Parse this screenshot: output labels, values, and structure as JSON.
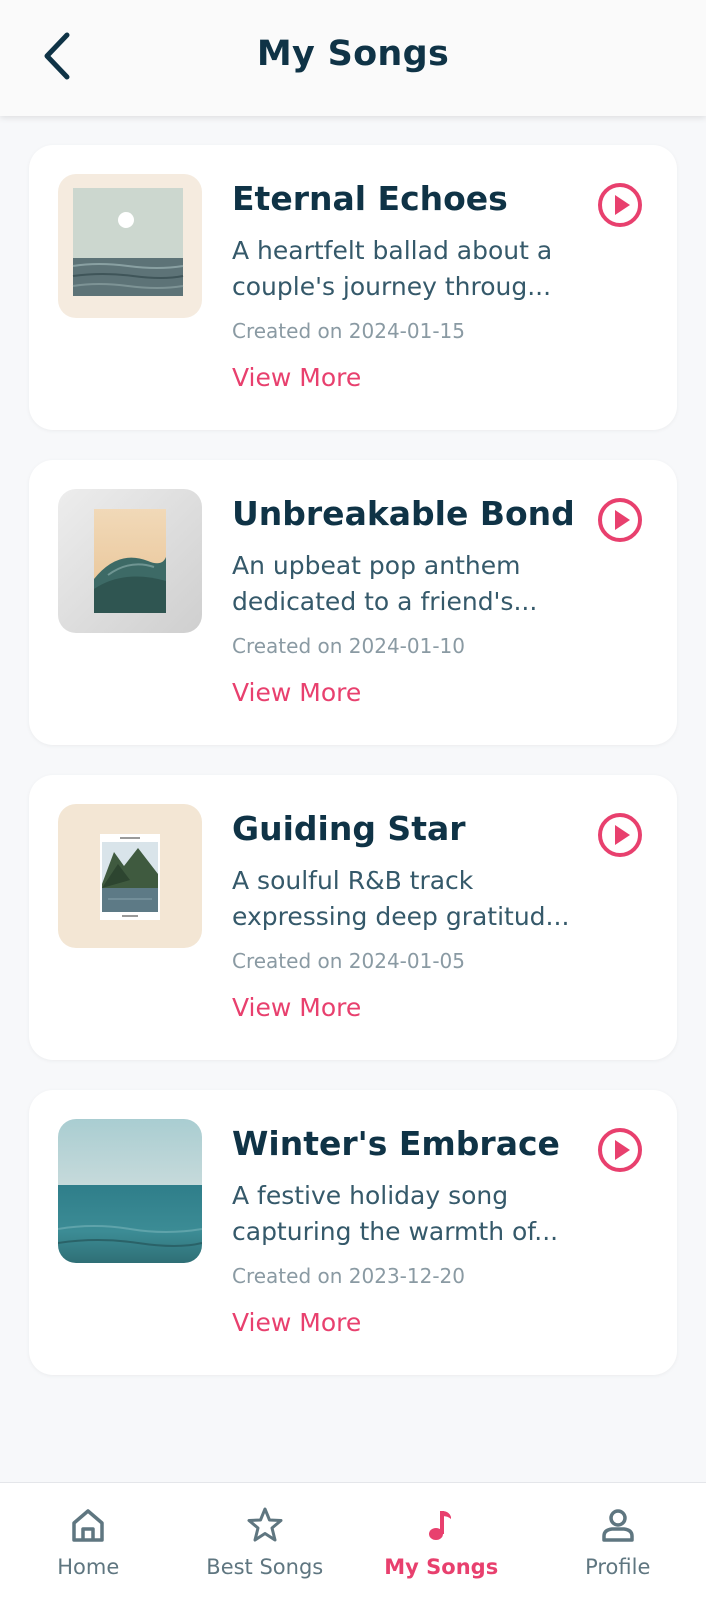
{
  "header": {
    "title": "My Songs",
    "back_icon": "chevron-left-icon"
  },
  "colors": {
    "accent": "#e8406e",
    "title": "#0f3346",
    "muted": "#8a9aa3"
  },
  "songs": [
    {
      "title": "Eternal Echoes",
      "desc_line1": "A heartfelt ballad about a",
      "desc_line2": "couple's journey throug...",
      "created": "Created on 2024-01-15",
      "view_more": "View More",
      "art": "sea-moon-art"
    },
    {
      "title": "Unbreakable Bond",
      "desc_line1": "An upbeat pop anthem",
      "desc_line2": "dedicated to a friend's...",
      "created": "Created on 2024-01-10",
      "view_more": "View More",
      "art": "wave-print-art"
    },
    {
      "title": "Guiding Star",
      "desc_line1": "A soulful R&B track",
      "desc_line2": "expressing deep gratitud...",
      "created": "Created on 2024-01-05",
      "view_more": "View More",
      "art": "fjord-poster-art"
    },
    {
      "title": "Winter's Embrace",
      "desc_line1": "A festive holiday song",
      "desc_line2": "capturing the warmth of...",
      "created": "Created on 2023-12-20",
      "view_more": "View More",
      "art": "ocean-horizon-art"
    }
  ],
  "nav": [
    {
      "label": "Home",
      "icon": "home-icon",
      "active": false
    },
    {
      "label": "Best Songs",
      "icon": "star-icon",
      "active": false
    },
    {
      "label": "My Songs",
      "icon": "music-note-icon",
      "active": true
    },
    {
      "label": "Profile",
      "icon": "profile-icon",
      "active": false
    }
  ]
}
